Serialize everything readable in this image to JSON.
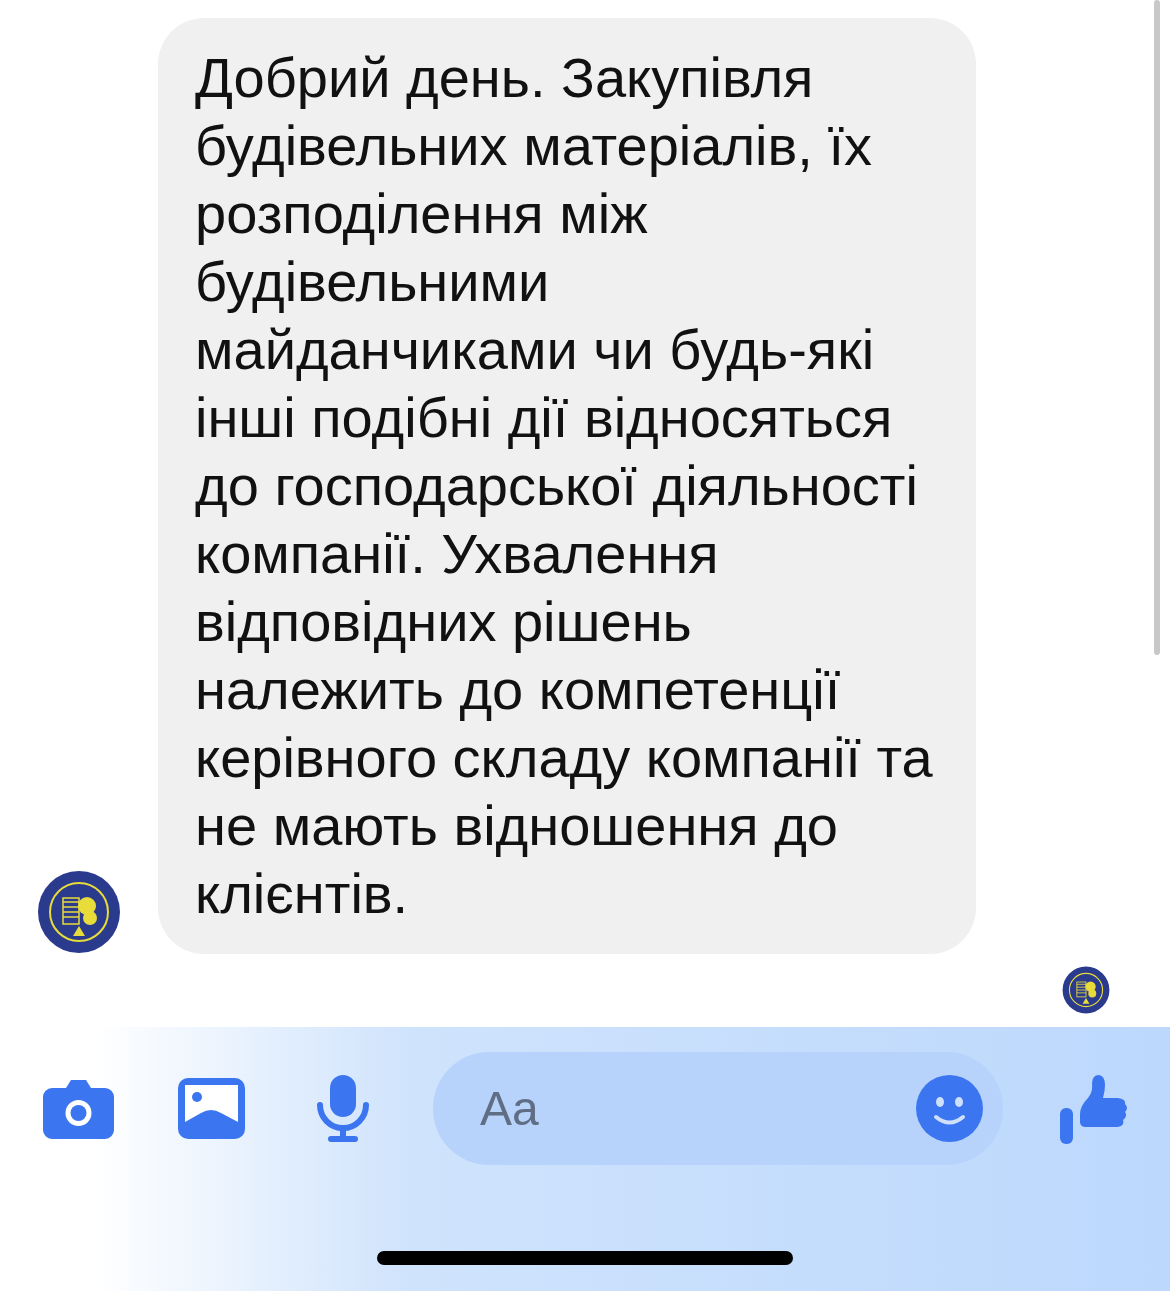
{
  "message": {
    "text": "Добрий день. Закупівля будівельних матеріалів, їх розподілення між будівельними майданчиками чи будь-які інші подібні дії відносяться до господарської діяльності компанії. Ухвалення відповідних рішень належить до компетенції керівного складу компанії та не мають відношення до клієнтів."
  },
  "composer": {
    "placeholder": "Aa"
  }
}
